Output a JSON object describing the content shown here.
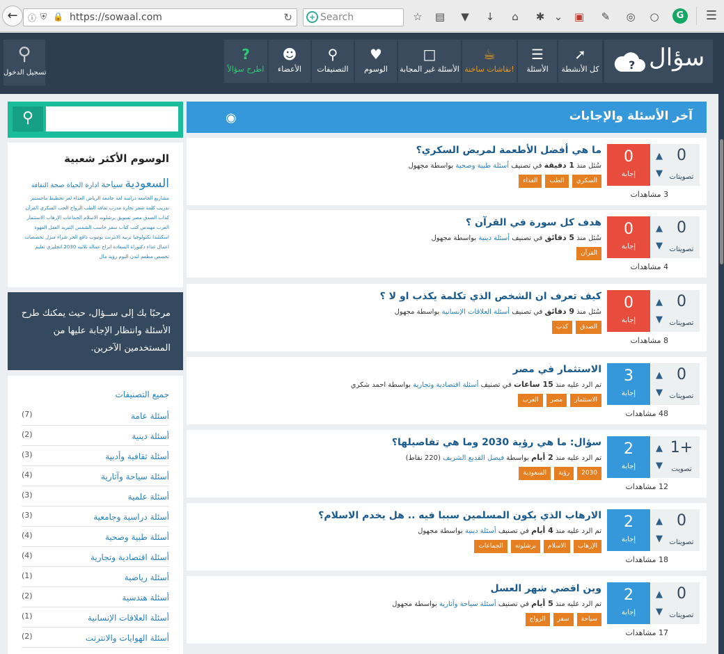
{
  "browser": {
    "url": "https://sowaal.com",
    "search_placeholder": "Search",
    "reload_icon": "reload-icon"
  },
  "site": {
    "logo_text": "سؤال",
    "login_label": "تسجيل الدخول",
    "nav": [
      {
        "label": "كل الأنشطة",
        "icon": "activity-chart-icon"
      },
      {
        "label": "الأسئلة",
        "icon": "list-icon"
      },
      {
        "label": "نقاشات ساخنة!",
        "icon": "hot-cup-icon"
      },
      {
        "label": "الأسئلة غير المجابة",
        "icon": "unanswered-icon"
      },
      {
        "label": "الوسوم",
        "icon": "tag-icon"
      },
      {
        "label": "التصنيفات",
        "icon": "categories-icon"
      },
      {
        "label": "الأعضاء",
        "icon": "users-icon"
      },
      {
        "label": "اطرح سؤالاً",
        "icon": "question-icon"
      }
    ]
  },
  "main": {
    "heading": "آخر الأسئلة والإجابات",
    "questions": [
      {
        "votes": "0",
        "votes_label": "تصويتات",
        "answers": "0",
        "answers_label": "إجابة",
        "answer_color": "red",
        "views": "3 مشاهدات",
        "title": "ما هي أفضل الأطعمة لمريض السكري؟",
        "meta_prefix": "سُئل منذ",
        "meta_time": "1 دقيقة",
        "meta_in": "في تصنيف",
        "meta_cat": "أسئلة طبية وصحية",
        "meta_by": "بواسطة مجهول",
        "tags": [
          "السكري",
          "الطب",
          "الغذاء"
        ]
      },
      {
        "votes": "0",
        "votes_label": "تصويتات",
        "answers": "0",
        "answers_label": "إجابة",
        "answer_color": "red",
        "views": "4 مشاهدات",
        "title": "هدف كل سورة في القرآن ؟",
        "meta_prefix": "سُئل منذ",
        "meta_time": "5 دقائق",
        "meta_in": "في تصنيف",
        "meta_cat": "أسئلة دينية",
        "meta_by": "بواسطة مجهول",
        "tags": [
          "القرآن"
        ]
      },
      {
        "votes": "0",
        "votes_label": "تصويتات",
        "answers": "0",
        "answers_label": "إجابة",
        "answer_color": "red",
        "views": "8 مشاهدات",
        "title": "كيف تعرف ان الشخص الذي تكلمة يكذب او لا ؟",
        "meta_prefix": "سُئل منذ",
        "meta_time": "9 دقائق",
        "meta_in": "في تصنيف",
        "meta_cat": "أسئلة العلاقات الإنسانية",
        "meta_by": "بواسطة مجهول",
        "tags": [
          "الصدق",
          "كذب"
        ]
      },
      {
        "votes": "0",
        "votes_label": "تصويتات",
        "answers": "3",
        "answers_label": "إجابة",
        "answer_color": "blue",
        "views": "48 مشاهدات",
        "title": "الاستثمار في مصر",
        "meta_prefix": "تم الرد عليه منذ",
        "meta_time": "15 ساعات",
        "meta_in": "في تصنيف",
        "meta_cat": "أسئلة اقتصادية وتجارية",
        "meta_by": "بواسطة احمد شكري",
        "tags": [
          "الاستثمار",
          "مصر",
          "العرب"
        ]
      },
      {
        "votes": "1+",
        "votes_label": "تصويت",
        "answers": "2",
        "answers_label": "إجابة",
        "answer_color": "blue",
        "views": "12 مشاهدات",
        "title": "سؤال: ما هي رؤية 2030 وما هي تفاصيلها؟",
        "meta_prefix": "تم الرد عليه منذ",
        "meta_time": "2 أيام",
        "meta_in": "بواسطة",
        "meta_cat": "فيصل القديع الشريف",
        "meta_by": "(220 نقاط)",
        "tags": [
          "2030",
          "رؤية",
          "السعودية"
        ]
      },
      {
        "votes": "0",
        "votes_label": "تصويتات",
        "answers": "2",
        "answers_label": "إجابة",
        "answer_color": "blue",
        "views": "18 مشاهدات",
        "title": "الارهاب الذي يكون المسلمين سببا فيه .. هل يخدم الاسلام؟",
        "meta_prefix": "تم الرد عليه منذ",
        "meta_time": "4 أيام",
        "meta_in": "في تصنيف",
        "meta_cat": "أسئلة دينية",
        "meta_by": "بواسطة مجهول",
        "tags": [
          "الإرهاب",
          "الاسلام",
          "برشلونه",
          "الجماعات"
        ]
      },
      {
        "votes": "0",
        "votes_label": "تصويتات",
        "answers": "2",
        "answers_label": "إجابة",
        "answer_color": "blue",
        "views": "17 مشاهدات",
        "title": "وين اقضي شهر العسل",
        "meta_prefix": "تم الرد عليه منذ",
        "meta_time": "5 أيام",
        "meta_in": "في تصنيف",
        "meta_cat": "أسئلة سياحة وآثارية",
        "meta_by": "بواسطة مجهول",
        "tags": [
          "سياحة",
          "سفر",
          "الزواج"
        ]
      }
    ]
  },
  "sidebar": {
    "search_placeholder": "",
    "tags_title": "الوسوم الأكثر شعبية",
    "tag_cloud_big": [
      "السعودية",
      "سياحة",
      "ادارة",
      "الحياة",
      "صحة",
      "الثقافة"
    ],
    "tag_cloud_small": "مشاريع الجامعة دراسة لغة جامعة الرياض الغذاء لغز تخطيط ماجستير تدريب كلمة شعر تجارة مدرب ثقافة الطب الزواج الحب السكري القرآن كذاب الصدق مصر تسويق برشلونه الاسلام الجماعات الإرهاب الاستثمار العرب مهندس كتب كتاب سفر حاسب الشمس التبريد العقل القهوة اسكتلندا تكنولوجيا تربية الانترنت يوتيوب دافع الحر شراء منزل تخصصات اعمال غذاء دكتوراة السعادة ابراج عمالة ثلاثيه 2030 انجليزي تعليم تخصص مطعم لندن النوم رؤية مال",
    "welcome_text": "مرحبًا بك إلى ســؤال، حيث يمكنك طرح الأسئلة وانتظار الإجابة عليها من المستخدمين الآخرين.",
    "categories_all": "جميع التصنيفات",
    "categories": [
      {
        "name": "أسئلة عامة",
        "count": "(7)"
      },
      {
        "name": "أسئلة دينية",
        "count": "(2)"
      },
      {
        "name": "أسئلة ثقافية وأدبية",
        "count": "(3)"
      },
      {
        "name": "أسئلة سياحة وآثارية",
        "count": "(4)"
      },
      {
        "name": "أسئلة علمية",
        "count": "(3)"
      },
      {
        "name": "أسئلة دراسية وجامعية",
        "count": "(3)"
      },
      {
        "name": "أسئلة طبية وصحية",
        "count": "(4)"
      },
      {
        "name": "أسئلة اقتصادية وتجارية",
        "count": "(4)"
      },
      {
        "name": "أسئلة رياضية",
        "count": "(1)"
      },
      {
        "name": "أسئلة هندسية",
        "count": "(2)"
      },
      {
        "name": "أسئلة العلاقات الإنسانية",
        "count": "(1)"
      },
      {
        "name": "أسئلة الهوايات والانترنت",
        "count": "(2)"
      }
    ]
  },
  "colors": {
    "header": "#2d3e50",
    "accent": "#3498db",
    "answered": "#3498db",
    "unanswered": "#e74c3c",
    "tag": "#e67e22",
    "search": "#1abc9c"
  }
}
